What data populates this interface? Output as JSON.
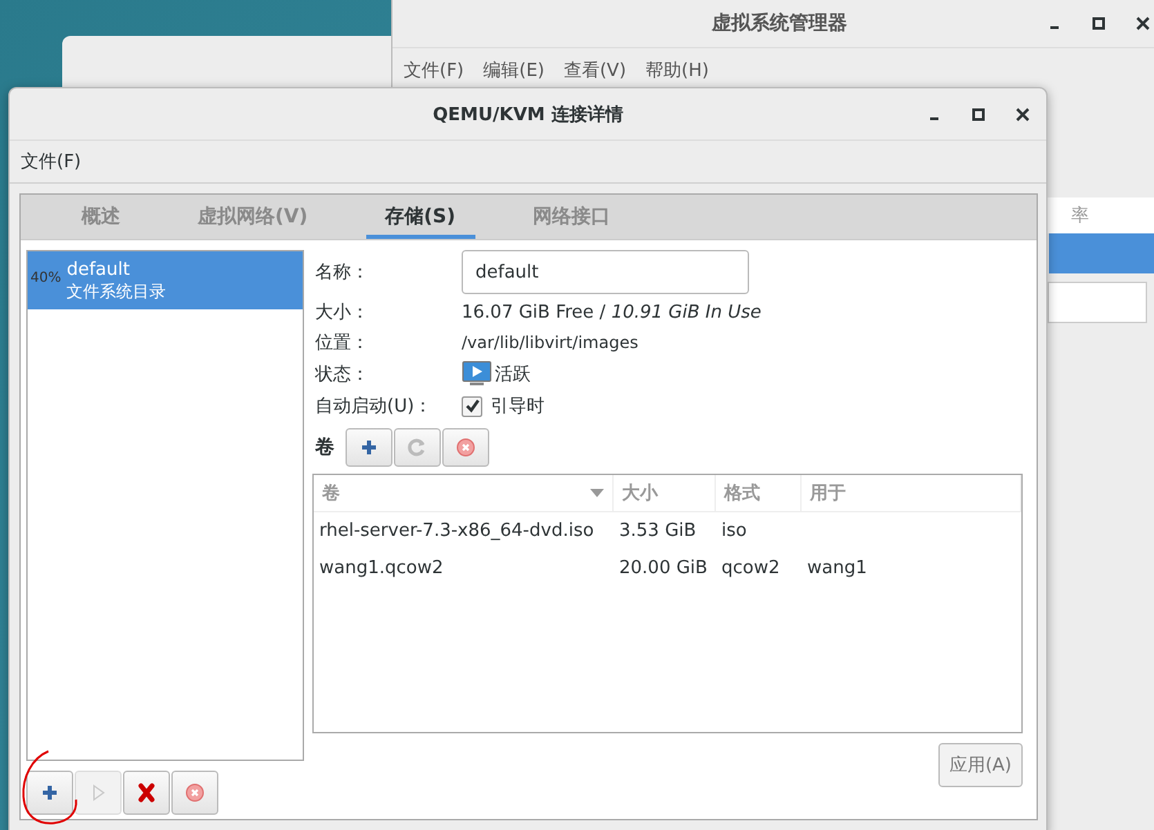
{
  "manager_window": {
    "title": "虚拟系统管理器",
    "menu": [
      "文件(F)",
      "编辑(E)",
      "查看(V)",
      "帮助(H)"
    ],
    "column_header": "率",
    "rows": [
      {
        "selected": true
      }
    ]
  },
  "window": {
    "title": "QEMU/KVM 连接详情",
    "menu": [
      "文件(F)"
    ]
  },
  "tabs": [
    {
      "label": "概述",
      "selected": false
    },
    {
      "label": "虚拟网络(V)",
      "selected": false
    },
    {
      "label": "存储(S)",
      "selected": true
    },
    {
      "label": "网络接口",
      "selected": false
    }
  ],
  "pools": [
    {
      "usage": "40%",
      "name": "default",
      "type": "文件系统目录",
      "selected": true
    }
  ],
  "details": {
    "name_label": "名称：",
    "name_value": "default",
    "size_label": "大小：",
    "free": "16.07 GiB Free / ",
    "in_use": "10.91 GiB In Use",
    "location_label": "位置：",
    "location": "/var/lib/libvirt/images",
    "state_label": "状态：",
    "state": "活跃",
    "autostart_label": "自动启动(U)：",
    "autostart": "引导时",
    "autostart_checked": true
  },
  "volumes": {
    "label": "卷",
    "columns": [
      "卷",
      "大小",
      "格式",
      "用于"
    ],
    "rows": [
      [
        "rhel-server-7.3-x86_64-dvd.iso",
        "3.53 GiB",
        "iso",
        ""
      ],
      [
        "wang1.qcow2",
        "20.00 GiB",
        "qcow2",
        "wang1"
      ]
    ]
  },
  "apply_button": {
    "label": "应用(A)",
    "disabled": true
  }
}
